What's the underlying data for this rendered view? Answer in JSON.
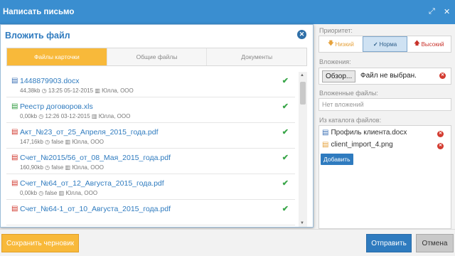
{
  "window": {
    "title": "Написать письмо",
    "expand_icon": "expand-icon",
    "close_icon": "close-icon"
  },
  "attach_panel": {
    "title": "Вложить файл",
    "tabs": [
      {
        "label": "Файлы карточки",
        "active": true
      },
      {
        "label": "Общие файлы",
        "active": false
      },
      {
        "label": "Документы",
        "active": false
      }
    ],
    "files": [
      {
        "name": "1448879903.docx",
        "type": "doc",
        "size": "44,38kb",
        "time": "13:25 05-12-2015",
        "owner": "Юлла, ООО",
        "status": "checked"
      },
      {
        "name": "Реестр договоров.xls",
        "type": "xls",
        "size": "0,00kb",
        "time": "12:26 03-12-2015",
        "owner": "Юлла, ООО",
        "status": "checked"
      },
      {
        "name": "Акт_№23_от_25_Апреля_2015_года.pdf",
        "type": "pdf",
        "size": "147,16kb",
        "time": "false",
        "owner": "Юлла, ООО",
        "status": "checked"
      },
      {
        "name": "Счет_№2015/56_от_08_Мая_2015_года.pdf",
        "type": "pdf",
        "size": "160,90kb",
        "time": "false",
        "owner": "Юлла, ООО",
        "status": "checked"
      },
      {
        "name": "Счет_№64_от_12_Августа_2015_года.pdf",
        "type": "pdf",
        "size": "0,00kb",
        "time": "false",
        "owner": "Юлла, ООО",
        "status": "checked"
      },
      {
        "name": "Счет_№64-1_от_10_Августа_2015_года.pdf",
        "type": "pdf",
        "size": "",
        "time": "",
        "owner": "",
        "status": "checked"
      }
    ]
  },
  "priority": {
    "label": "Приоритет:",
    "options": [
      {
        "label": "Низкий",
        "arrow": "🡇",
        "selected": false
      },
      {
        "label": "Норма",
        "arrow": "✓",
        "selected": true
      },
      {
        "label": "Высокий",
        "arrow": "🡅",
        "selected": false
      }
    ]
  },
  "attachments": {
    "label": "Вложения:",
    "browse_label": "Обзор...",
    "file_status": "Файл не выбран."
  },
  "attached_files": {
    "label": "Вложенные файлы:",
    "value": "Нет вложений"
  },
  "catalog": {
    "label": "Из каталога файлов:",
    "items": [
      {
        "name": "Профиль клиента.docx",
        "type": "doc"
      },
      {
        "name": "client_import_4.png",
        "type": "png"
      }
    ],
    "add_label": "Добавить"
  },
  "footer": {
    "draft_label": "Сохранить черновик",
    "send_label": "Отправить",
    "cancel_label": "Отмена"
  },
  "colors": {
    "accent": "#3a8ed0",
    "orange": "#f8b93a",
    "check": "#3aa64a",
    "delete": "#d33b30"
  }
}
